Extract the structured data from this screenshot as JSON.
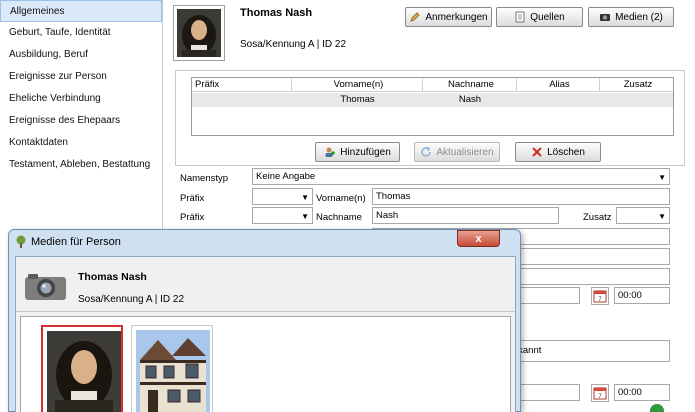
{
  "sidebar": {
    "items": [
      {
        "label": "Allgemeines",
        "active": true
      },
      {
        "label": "Geburt, Taufe, Identität"
      },
      {
        "label": "Ausbildung, Beruf"
      },
      {
        "label": "Ereignisse zur Person"
      },
      {
        "label": "Eheliche Verbindung"
      },
      {
        "label": "Ereignisse des Ehepaars"
      },
      {
        "label": "Kontaktdaten"
      },
      {
        "label": "Testament, Ableben, Bestattung"
      }
    ]
  },
  "person": {
    "name": "Thomas Nash",
    "id_text": "Sosa/Kennung A | ID 22"
  },
  "toolbar": {
    "notes_label": "Anmerkungen",
    "sources_label": "Quellen",
    "media_label": "Medien (2)"
  },
  "names_table": {
    "columns": [
      "Präfix",
      "Vorname(n)",
      "Nachname",
      "Alias",
      "Zusatz"
    ],
    "rows": [
      {
        "praefix": "",
        "vorname": "Thomas",
        "nachname": "Nash",
        "alias": "",
        "zusatz": ""
      }
    ]
  },
  "table_actions": {
    "add_label": "Hinzufügen",
    "update_label": "Aktualisieren",
    "delete_label": "Löschen"
  },
  "form": {
    "namenstyp_label": "Namenstyp",
    "namenstyp_value": "Keine Angabe",
    "praefix_label": "Präfix",
    "vorname_label": "Vorname(n)",
    "vorname_value": "Thomas",
    "nachname_label": "Nachname",
    "nachname_value": "Nash",
    "zusatz_label": "Zusatz",
    "time_value_1": "00:00",
    "time_value_2": "00:00",
    "unbekannt_text": "unbekannt"
  },
  "dialog": {
    "title": "Medien für Person",
    "close_label": "x",
    "name": "Thomas Nash",
    "id_text": "Sosa/Kennung A | ID 22"
  },
  "colors": {
    "sidebar_active": "#dbe9f9",
    "dialog_frame": "#cfe0f1",
    "close_button": "#c74b36",
    "selected_thumb": "#d32f2f"
  }
}
